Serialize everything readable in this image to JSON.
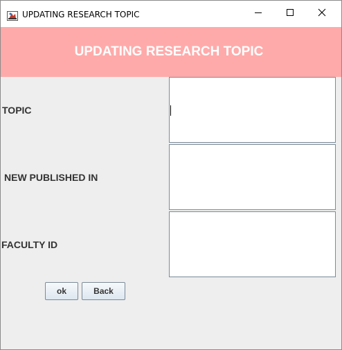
{
  "window": {
    "title": "UPDATING RESEARCH TOPIC"
  },
  "icons": {
    "app": "java-app-icon",
    "minimize": "minimize-icon",
    "maximize": "maximize-icon",
    "close": "close-icon"
  },
  "header": {
    "title": "UPDATING RESEARCH TOPIC",
    "background": "#ffaaaa",
    "text_color": "#ffffff"
  },
  "form": {
    "fields": [
      {
        "label": "TOPIC",
        "value": ""
      },
      {
        "label": "NEW PUBLISHED IN",
        "value": ""
      },
      {
        "label": "FACULTY ID",
        "value": ""
      }
    ]
  },
  "buttons": {
    "ok": "ok",
    "back": "Back"
  }
}
